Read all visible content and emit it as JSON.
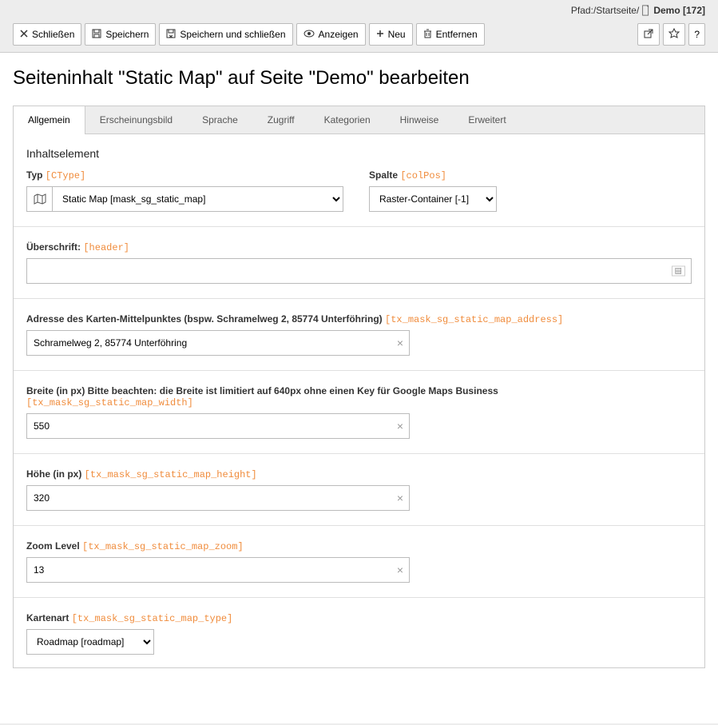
{
  "topbar": {
    "path_label": "Pfad: ",
    "root": "/Startseite/",
    "current": "Demo [172]"
  },
  "toolbar": {
    "close": "Schließen",
    "save": "Speichern",
    "save_close": "Speichern und schließen",
    "view": "Anzeigen",
    "new": "Neu",
    "delete": "Entfernen",
    "help": "?"
  },
  "page_title": "Seiteninhalt \"Static Map\" auf Seite \"Demo\" bearbeiten",
  "tabs": {
    "general": "Allgemein",
    "appearance": "Erscheinungsbild",
    "language": "Sprache",
    "access": "Zugriff",
    "categories": "Kategorien",
    "notes": "Hinweise",
    "extended": "Erweitert"
  },
  "section_head": "Inhaltselement",
  "fields": {
    "type": {
      "label": "Typ",
      "tech": "[CType]",
      "value": "Static Map [mask_sg_static_map]"
    },
    "column": {
      "label": "Spalte",
      "tech": "[colPos]",
      "value": "Raster-Container [-1]"
    },
    "header": {
      "label": "Überschrift:",
      "tech": "[header]",
      "value": ""
    },
    "address": {
      "label": "Adresse des Karten-Mittelpunktes (bspw. Schramelweg 2, 85774 Unterföhring)",
      "tech": "[tx_mask_sg_static_map_address]",
      "value": "Schramelweg 2, 85774 Unterföhring"
    },
    "width": {
      "label": "Breite (in px) Bitte beachten: die Breite ist limitiert auf 640px ohne einen Key für Google Maps Business",
      "tech": "[tx_mask_sg_static_map_width]",
      "value": "550"
    },
    "height": {
      "label": "Höhe (in px)",
      "tech": "[tx_mask_sg_static_map_height]",
      "value": "320"
    },
    "zoom": {
      "label": "Zoom Level",
      "tech": "[tx_mask_sg_static_map_zoom]",
      "value": "13"
    },
    "maptype": {
      "label": "Kartenart",
      "tech": "[tx_mask_sg_static_map_type]",
      "value": "Roadmap [roadmap]"
    }
  }
}
